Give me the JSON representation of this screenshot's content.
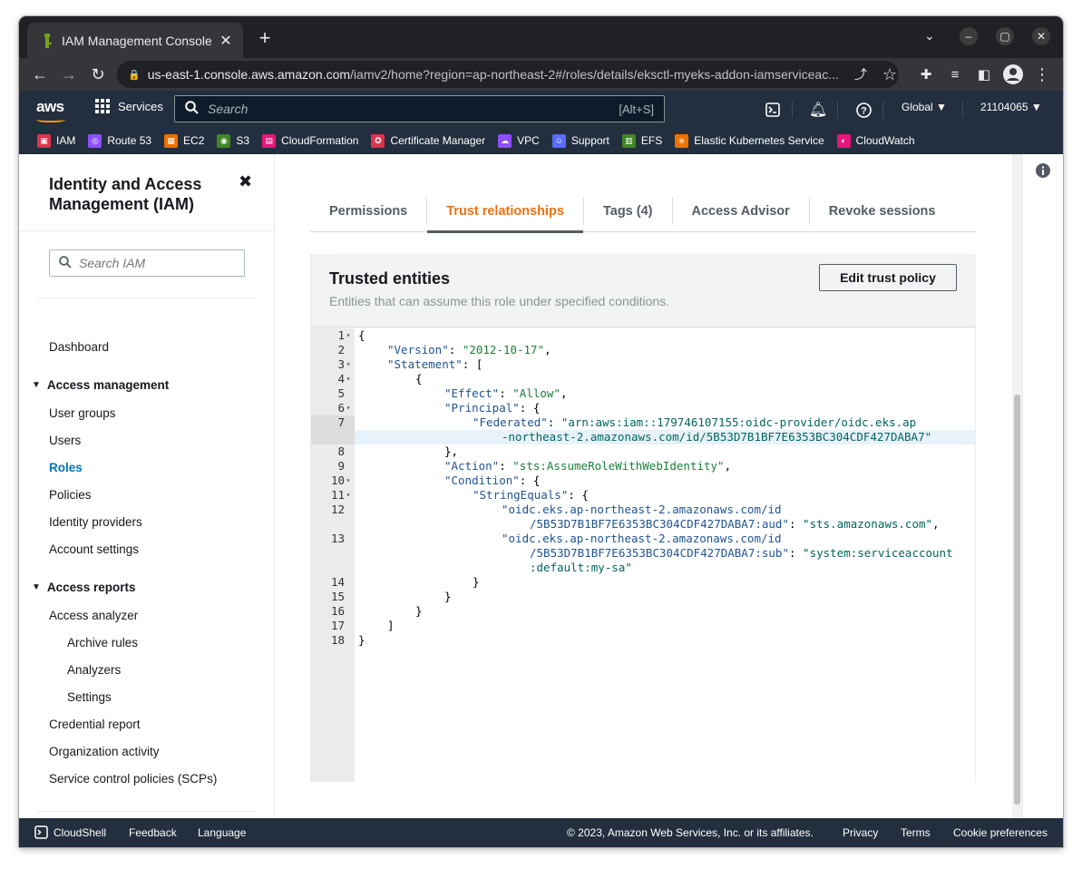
{
  "browser": {
    "tab_title": "IAM Management Console",
    "url_host": "us-east-1.console.aws.amazon.com",
    "url_path": "/iamv2/home?region=ap-northeast-2#/roles/details/eksctl-myeks-addon-iamserviceac...",
    "close_icon": "close-icon",
    "newtab_icon": "plus-icon"
  },
  "aws": {
    "logo": "aws",
    "services_label": "Services",
    "search_placeholder": "Search",
    "search_shortcut": "[Alt+S]",
    "region": "Global ▼",
    "account": "21104065 ▼",
    "favorites": [
      {
        "label": "IAM",
        "color": "#dd344c"
      },
      {
        "label": "Route 53",
        "color": "#8c4fff"
      },
      {
        "label": "EC2",
        "color": "#ed7100"
      },
      {
        "label": "S3",
        "color": "#3f8624"
      },
      {
        "label": "CloudFormation",
        "color": "#e7157b"
      },
      {
        "label": "Certificate Manager",
        "color": "#dd344c"
      },
      {
        "label": "VPC",
        "color": "#8c4fff"
      },
      {
        "label": "Support",
        "color": "#5a6bff"
      },
      {
        "label": "EFS",
        "color": "#3f8624"
      },
      {
        "label": "Elastic Kubernetes Service",
        "color": "#ed7100"
      },
      {
        "label": "CloudWatch",
        "color": "#e7157b"
      }
    ]
  },
  "sidebar": {
    "title": "Identity and Access Management (IAM)",
    "close": "✖",
    "search_placeholder": "Search IAM",
    "dashboard": "Dashboard",
    "access_management": "Access management",
    "user_groups": "User groups",
    "users": "Users",
    "roles": "Roles",
    "policies": "Policies",
    "identity_providers": "Identity providers",
    "account_settings": "Account settings",
    "access_reports": "Access reports",
    "access_analyzer": "Access analyzer",
    "archive_rules": "Archive rules",
    "analyzers": "Analyzers",
    "settings": "Settings",
    "credential_report": "Credential report",
    "organization_activity": "Organization activity",
    "scps": "Service control policies (SCPs)"
  },
  "tabs": {
    "permissions": "Permissions",
    "trust": "Trust relationships",
    "tags": "Tags (4)",
    "advisor": "Access Advisor",
    "revoke": "Revoke sessions"
  },
  "panel": {
    "title": "Trusted entities",
    "description": "Entities that can assume this role under specified conditions.",
    "edit_button": "Edit trust policy"
  },
  "code": {
    "line_numbers": [
      "1",
      "2",
      "3",
      "4",
      "5",
      "6",
      "7",
      "8",
      "9",
      "10",
      "11",
      "12",
      "13",
      "14",
      "15",
      "16",
      "17",
      "18"
    ],
    "l1": "{",
    "l2a": "\"Version\"",
    "l2b": "\"2012-10-17\"",
    "l3a": "\"Statement\"",
    "l3b": "[",
    "l4": "{",
    "l5a": "\"Effect\"",
    "l5b": "\"Allow\"",
    "l6a": "\"Principal\"",
    "l6b": "{",
    "l7a": "\"Federated\"",
    "l7b": "\"arn:aws:iam::179746107155:oidc-provider/oidc.eks.ap",
    "l7c": "-northeast-2.amazonaws.com/id/5B53D7B1BF7E6353BC304CDF427DABA7\"",
    "l8": "},",
    "l9a": "\"Action\"",
    "l9b": "\"sts:AssumeRoleWithWebIdentity\"",
    "l10a": "\"Condition\"",
    "l10b": "{",
    "l11a": "\"StringEquals\"",
    "l11b": "{",
    "l12a": "\"oidc.eks.ap-northeast-2.amazonaws.com/id",
    "l12b": "/5B53D7B1BF7E6353BC304CDF427DABA7:aud\"",
    "l12c": "\"sts.amazonaws.com\"",
    "l13a": "\"oidc.eks.ap-northeast-2.amazonaws.com/id",
    "l13b": "/5B53D7B1BF7E6353BC304CDF427DABA7:sub\"",
    "l13c": "\"system:serviceaccount",
    "l13d": ":default:my-sa\"",
    "l14": "}",
    "l15": "}",
    "l16": "}",
    "l17": "]",
    "l18": "}"
  },
  "footer": {
    "cloudshell": "CloudShell",
    "feedback": "Feedback",
    "language": "Language",
    "copyright": "© 2023, Amazon Web Services, Inc. or its affiliates.",
    "privacy": "Privacy",
    "terms": "Terms",
    "cookies": "Cookie preferences"
  }
}
